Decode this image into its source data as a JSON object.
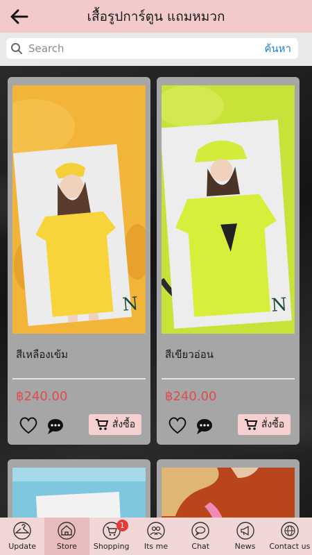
{
  "header": {
    "title": "เสื้อรูปการ์ตูน แถมหมวก"
  },
  "search": {
    "placeholder": "Search",
    "button_label": "ค้นหา"
  },
  "products": [
    {
      "name": "สีเหลืองเข้ม",
      "price": "฿240.00",
      "order_label": "สั่งซื้อ",
      "image_colors": {
        "bg": "#f2b53a",
        "photo": "#f5d03a"
      }
    },
    {
      "name": "สีเขียวอ่อน",
      "price": "฿240.00",
      "order_label": "สั่งซื้อ",
      "image_colors": {
        "bg": "#c8e23a",
        "photo": "#d6ec3b"
      }
    },
    {
      "image_colors": {
        "bg": "#7fc7df"
      }
    },
    {
      "image_colors": {
        "bg": "#b9451c"
      }
    }
  ],
  "tabs": [
    {
      "label": "Update",
      "icon": "hanger-icon"
    },
    {
      "label": "Store",
      "icon": "store-icon"
    },
    {
      "label": "Shopping",
      "icon": "cart-icon",
      "badge": "1"
    },
    {
      "label": "Its me",
      "icon": "people-icon"
    },
    {
      "label": "Chat",
      "icon": "chat-icon"
    },
    {
      "label": "News",
      "icon": "megaphone-icon"
    },
    {
      "label": "Contact us",
      "icon": "globe-icon"
    }
  ],
  "colors": {
    "header": "#f3caca",
    "accent": "#1b7fd4",
    "price": "#e14b4b",
    "badge": "#e53a3a"
  }
}
